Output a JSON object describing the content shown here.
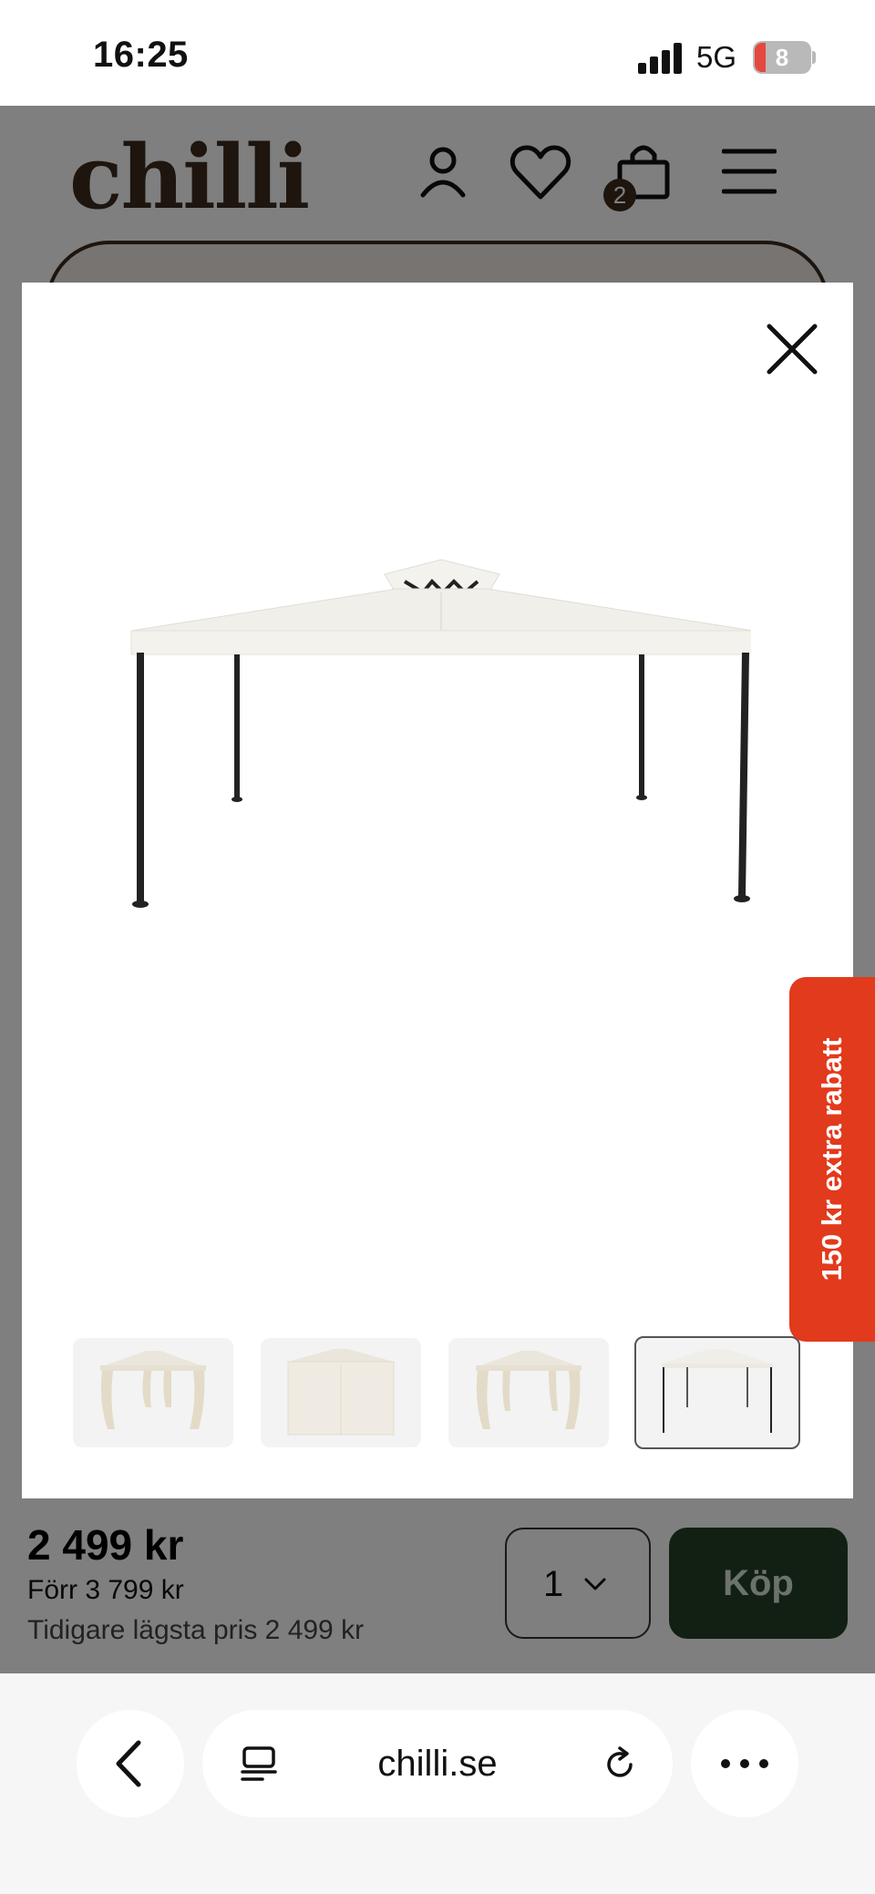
{
  "status_bar": {
    "time": "16:25",
    "network": "5G",
    "battery": "8"
  },
  "site": {
    "logo": "chilli",
    "cart_count": "2",
    "buy_bar": {
      "price": "2 499 kr",
      "before_price": "Förr 3 799 kr",
      "lowest_price": "Tidigare lägsta pris 2 499 kr",
      "quantity": "1",
      "buy_label": "Köp"
    }
  },
  "promo": {
    "label": "150 kr extra rabatt"
  },
  "gallery": {
    "thumbnails": [
      {
        "kind": "gazebo-with-curtains"
      },
      {
        "kind": "gazebo-closed-walls"
      },
      {
        "kind": "gazebo-with-curtains"
      },
      {
        "kind": "gazebo-frame",
        "selected": true
      }
    ]
  },
  "browser": {
    "url": "chilli.se"
  },
  "colors": {
    "brand": "#3a2a1c",
    "buy_button": "#244029",
    "promo": "#e23a1c"
  }
}
